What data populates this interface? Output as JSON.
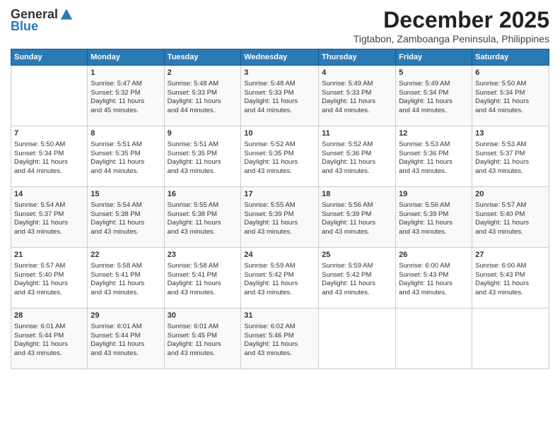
{
  "logo": {
    "general": "General",
    "blue": "Blue"
  },
  "header": {
    "month_year": "December 2025",
    "location": "Tigtabon, Zamboanga Peninsula, Philippines"
  },
  "days_header": [
    "Sunday",
    "Monday",
    "Tuesday",
    "Wednesday",
    "Thursday",
    "Friday",
    "Saturday"
  ],
  "weeks": [
    [
      {
        "day": "",
        "info": ""
      },
      {
        "day": "1",
        "info": "Sunrise: 5:47 AM\nSunset: 5:32 PM\nDaylight: 11 hours\nand 45 minutes."
      },
      {
        "day": "2",
        "info": "Sunrise: 5:48 AM\nSunset: 5:33 PM\nDaylight: 11 hours\nand 44 minutes."
      },
      {
        "day": "3",
        "info": "Sunrise: 5:48 AM\nSunset: 5:33 PM\nDaylight: 11 hours\nand 44 minutes."
      },
      {
        "day": "4",
        "info": "Sunrise: 5:49 AM\nSunset: 5:33 PM\nDaylight: 11 hours\nand 44 minutes."
      },
      {
        "day": "5",
        "info": "Sunrise: 5:49 AM\nSunset: 5:34 PM\nDaylight: 11 hours\nand 44 minutes."
      },
      {
        "day": "6",
        "info": "Sunrise: 5:50 AM\nSunset: 5:34 PM\nDaylight: 11 hours\nand 44 minutes."
      }
    ],
    [
      {
        "day": "7",
        "info": "Sunrise: 5:50 AM\nSunset: 5:34 PM\nDaylight: 11 hours\nand 44 minutes."
      },
      {
        "day": "8",
        "info": "Sunrise: 5:51 AM\nSunset: 5:35 PM\nDaylight: 11 hours\nand 44 minutes."
      },
      {
        "day": "9",
        "info": "Sunrise: 5:51 AM\nSunset: 5:35 PM\nDaylight: 11 hours\nand 43 minutes."
      },
      {
        "day": "10",
        "info": "Sunrise: 5:52 AM\nSunset: 5:35 PM\nDaylight: 11 hours\nand 43 minutes."
      },
      {
        "day": "11",
        "info": "Sunrise: 5:52 AM\nSunset: 5:36 PM\nDaylight: 11 hours\nand 43 minutes."
      },
      {
        "day": "12",
        "info": "Sunrise: 5:53 AM\nSunset: 5:36 PM\nDaylight: 11 hours\nand 43 minutes."
      },
      {
        "day": "13",
        "info": "Sunrise: 5:53 AM\nSunset: 5:37 PM\nDaylight: 11 hours\nand 43 minutes."
      }
    ],
    [
      {
        "day": "14",
        "info": "Sunrise: 5:54 AM\nSunset: 5:37 PM\nDaylight: 11 hours\nand 43 minutes."
      },
      {
        "day": "15",
        "info": "Sunrise: 5:54 AM\nSunset: 5:38 PM\nDaylight: 11 hours\nand 43 minutes."
      },
      {
        "day": "16",
        "info": "Sunrise: 5:55 AM\nSunset: 5:38 PM\nDaylight: 11 hours\nand 43 minutes."
      },
      {
        "day": "17",
        "info": "Sunrise: 5:55 AM\nSunset: 5:39 PM\nDaylight: 11 hours\nand 43 minutes."
      },
      {
        "day": "18",
        "info": "Sunrise: 5:56 AM\nSunset: 5:39 PM\nDaylight: 11 hours\nand 43 minutes."
      },
      {
        "day": "19",
        "info": "Sunrise: 5:56 AM\nSunset: 5:39 PM\nDaylight: 11 hours\nand 43 minutes."
      },
      {
        "day": "20",
        "info": "Sunrise: 5:57 AM\nSunset: 5:40 PM\nDaylight: 11 hours\nand 43 minutes."
      }
    ],
    [
      {
        "day": "21",
        "info": "Sunrise: 5:57 AM\nSunset: 5:40 PM\nDaylight: 11 hours\nand 43 minutes."
      },
      {
        "day": "22",
        "info": "Sunrise: 5:58 AM\nSunset: 5:41 PM\nDaylight: 11 hours\nand 43 minutes."
      },
      {
        "day": "23",
        "info": "Sunrise: 5:58 AM\nSunset: 5:41 PM\nDaylight: 11 hours\nand 43 minutes."
      },
      {
        "day": "24",
        "info": "Sunrise: 5:59 AM\nSunset: 5:42 PM\nDaylight: 11 hours\nand 43 minutes."
      },
      {
        "day": "25",
        "info": "Sunrise: 5:59 AM\nSunset: 5:42 PM\nDaylight: 11 hours\nand 43 minutes."
      },
      {
        "day": "26",
        "info": "Sunrise: 6:00 AM\nSunset: 5:43 PM\nDaylight: 11 hours\nand 43 minutes."
      },
      {
        "day": "27",
        "info": "Sunrise: 6:00 AM\nSunset: 5:43 PM\nDaylight: 11 hours\nand 43 minutes."
      }
    ],
    [
      {
        "day": "28",
        "info": "Sunrise: 6:01 AM\nSunset: 5:44 PM\nDaylight: 11 hours\nand 43 minutes."
      },
      {
        "day": "29",
        "info": "Sunrise: 6:01 AM\nSunset: 5:44 PM\nDaylight: 11 hours\nand 43 minutes."
      },
      {
        "day": "30",
        "info": "Sunrise: 6:01 AM\nSunset: 5:45 PM\nDaylight: 11 hours\nand 43 minutes."
      },
      {
        "day": "31",
        "info": "Sunrise: 6:02 AM\nSunset: 5:46 PM\nDaylight: 11 hours\nand 43 minutes."
      },
      {
        "day": "",
        "info": ""
      },
      {
        "day": "",
        "info": ""
      },
      {
        "day": "",
        "info": ""
      }
    ]
  ]
}
